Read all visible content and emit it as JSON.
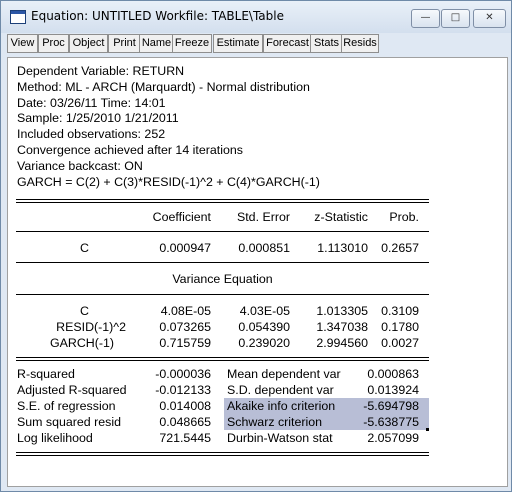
{
  "window": {
    "title": "Equation: UNTITLED   Workfile: TABLE\\Table",
    "controls": {
      "minimize": "—",
      "maximize": "□",
      "close": "✕"
    }
  },
  "toolbar": [
    "View",
    "Proc",
    "Object",
    "Print",
    "Name",
    "Freeze",
    "Estimate",
    "Forecast",
    "Stats",
    "Resids"
  ],
  "header_lines": [
    "Dependent Variable: RETURN",
    "Method: ML - ARCH (Marquardt) - Normal distribution",
    "Date: 03/26/11   Time: 14:01",
    "Sample: 1/25/2010 1/21/2011",
    "Included observations: 252",
    "Convergence achieved after 14 iterations",
    "Variance backcast: ON",
    "GARCH = C(2) + C(3)*RESID(-1)^2 + C(4)*GARCH(-1)"
  ],
  "coef_table": {
    "columns": [
      "Coefficient",
      "Std. Error",
      "z-Statistic",
      "Prob."
    ],
    "mean_rows": [
      {
        "variable": "C",
        "coefficient": "0.000947",
        "std_error": "0.000851",
        "z_statistic": "1.113010",
        "prob": "0.2657"
      }
    ],
    "variance_title": "Variance Equation",
    "variance_rows": [
      {
        "variable": "C",
        "coefficient": "4.08E-05",
        "std_error": "4.03E-05",
        "z_statistic": "1.013305",
        "prob": "0.3109"
      },
      {
        "variable": "RESID(-1)^2",
        "coefficient": "0.073265",
        "std_error": "0.054390",
        "z_statistic": "1.347038",
        "prob": "0.1780"
      },
      {
        "variable": "GARCH(-1)",
        "coefficient": "0.715759",
        "std_error": "0.239020",
        "z_statistic": "2.994560",
        "prob": "0.0027"
      }
    ]
  },
  "stats": [
    {
      "label": "R-squared",
      "value": "-0.000036",
      "label2": "Mean dependent var",
      "value2": "0.000863"
    },
    {
      "label": "Adjusted R-squared",
      "value": "-0.012133",
      "label2": "S.D. dependent var",
      "value2": "0.013924"
    },
    {
      "label": "S.E. of regression",
      "value": "0.014008",
      "label2": "Akaike info criterion",
      "value2": "-5.694798"
    },
    {
      "label": "Sum squared resid",
      "value": "0.048665",
      "label2": "Schwarz criterion",
      "value2": "-5.638775"
    },
    {
      "label": "Log likelihood",
      "value": "721.5445",
      "label2": "Durbin-Watson stat",
      "value2": "2.057099"
    }
  ],
  "highlight_color": "#b8bed6"
}
